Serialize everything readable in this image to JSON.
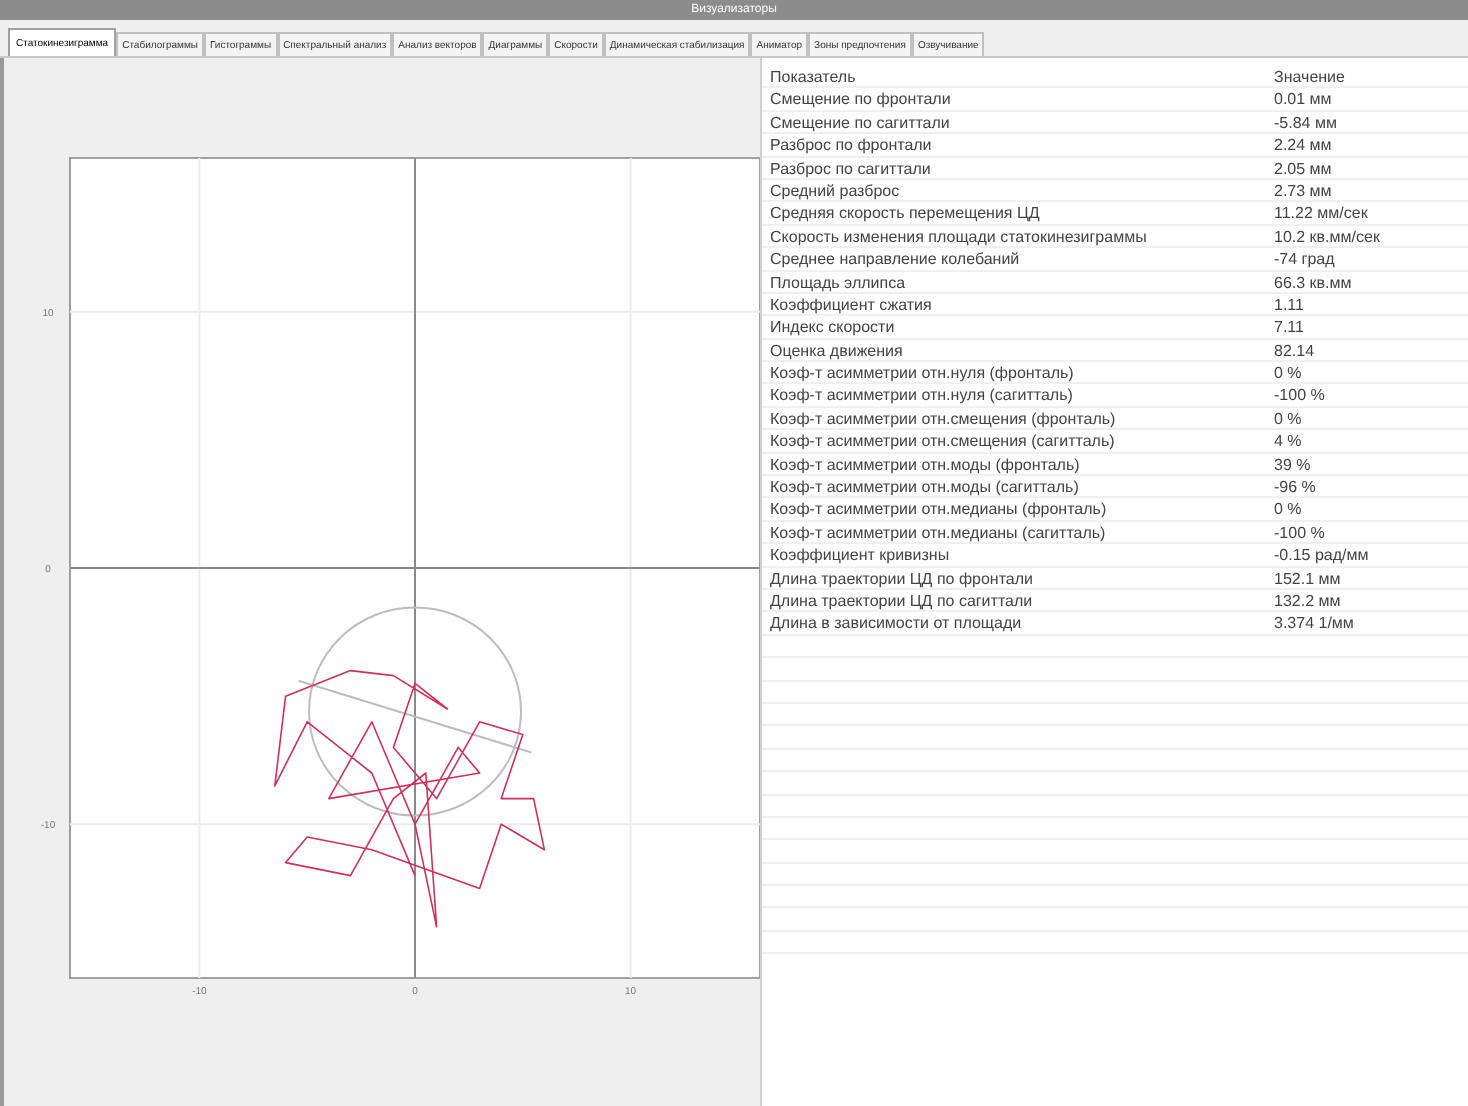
{
  "window": {
    "title": "Визуализаторы"
  },
  "tabs": [
    {
      "label": "Статокинезиграмма",
      "selected": true
    },
    {
      "label": "Стабилограммы",
      "selected": false
    },
    {
      "label": "Гистограммы",
      "selected": false
    },
    {
      "label": "Спектральный анализ",
      "selected": false
    },
    {
      "label": "Анализ векторов",
      "selected": false
    },
    {
      "label": "Диаграммы",
      "selected": false
    },
    {
      "label": "Скорости",
      "selected": false
    },
    {
      "label": "Динамическая стабилизация",
      "selected": false
    },
    {
      "label": "Аниматор",
      "selected": false
    },
    {
      "label": "Зоны предпочтения",
      "selected": false
    },
    {
      "label": "Озвучивание",
      "selected": false
    }
  ],
  "plot": {
    "chart_data": {
      "type": "line",
      "grid": true,
      "xlim": [
        -16,
        16
      ],
      "ylim": [
        -16,
        16
      ],
      "xticks": [
        -10,
        0,
        10
      ],
      "yticks": [
        -10,
        0,
        10
      ],
      "x": [
        0,
        -2,
        -5,
        -6.5,
        -6,
        -3,
        -1,
        1.5,
        0,
        -1,
        1,
        3,
        5,
        4,
        5.5,
        6,
        4,
        3,
        -2,
        -5,
        -6,
        -3,
        -1,
        0.5,
        1,
        0,
        2,
        3,
        -4,
        -2,
        0
      ],
      "series": [
        {
          "color": "#d0305a",
          "values": [
            -12,
            -8,
            -6,
            -8.5,
            -5,
            -4,
            -4.2,
            -5.5,
            -4.5,
            -7,
            -9,
            -6,
            -6.5,
            -9,
            -9,
            -11,
            -10,
            -12.5,
            -11,
            -10.5,
            -11.5,
            -12,
            -9,
            -8,
            -14,
            -10,
            -7,
            -8,
            -9,
            -6,
            -10
          ]
        }
      ]
    }
  },
  "table": {
    "columns": [
      "Показатель",
      "Значение"
    ],
    "rows": [
      [
        "Смещение по фронтали",
        "0.01 мм"
      ],
      [
        "Смещение по сагиттали",
        "-5.84 мм"
      ],
      [
        "Разброс по фронтали",
        "2.24 мм"
      ],
      [
        "Разброс по сагиттали",
        "2.05 мм"
      ],
      [
        "Средний разброс",
        "2.73 мм"
      ],
      [
        "Средняя скорость перемещения ЦД",
        "11.22 мм/сек"
      ],
      [
        "Скорость изменения площади статокинезиграммы",
        "10.2 кв.мм/сек"
      ],
      [
        "Среднее направление колебаний",
        "-74 град"
      ],
      [
        "Площадь эллипса",
        "66.3 кв.мм"
      ],
      [
        "Коэффициент сжатия",
        "1.11"
      ],
      [
        "Индекс скорости",
        "7.11"
      ],
      [
        "Оценка движения",
        "82.14"
      ],
      [
        "Коэф-т асимметрии отн.нуля (фронталь)",
        "0 %"
      ],
      [
        "Коэф-т асимметрии отн.нуля (сагитталь)",
        "-100 %"
      ],
      [
        "Коэф-т асимметрии отн.смещения (фронталь)",
        "0 %"
      ],
      [
        "Коэф-т асимметрии отн.смещения (сагитталь)",
        "4 %"
      ],
      [
        "Коэф-т асимметрии отн.моды (фронталь)",
        "39 %"
      ],
      [
        "Коэф-т асимметрии отн.моды (сагитталь)",
        "-96 %"
      ],
      [
        "Коэф-т асимметрии отн.медианы (фронталь)",
        "0 %"
      ],
      [
        "Коэф-т асимметрии отн.медианы (сагитталь)",
        "-100 %"
      ],
      [
        "Коэффициент кривизны",
        "-0.15 рад/мм"
      ],
      [
        "Длина траектории ЦД по фронтали",
        "152.1 мм"
      ],
      [
        "Длина траектории ЦД по сагиттали",
        "132.2 мм"
      ],
      [
        "Длина в зависимости от площади",
        "3.374 1/мм"
      ]
    ]
  }
}
